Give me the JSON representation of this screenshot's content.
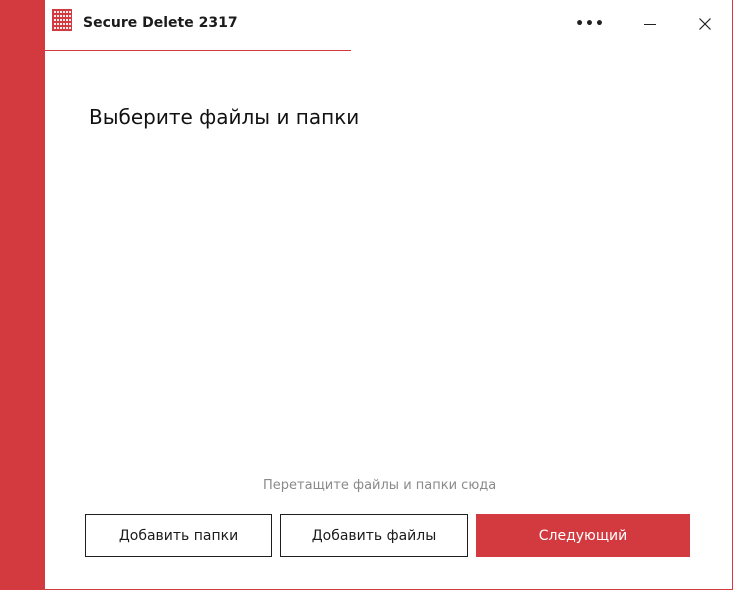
{
  "app": {
    "title": "Secure Delete 2317",
    "logo_icon": "binary-code-icon"
  },
  "window_controls": {
    "more_label": "•••",
    "minimize_icon": "minimize-icon",
    "close_icon": "close-icon"
  },
  "main": {
    "heading": "Выберите файлы и папки",
    "drop_hint": "Перетащите файлы и папки сюда"
  },
  "buttons": {
    "add_folders": "Добавить папки",
    "add_files": "Добавить файлы",
    "next": "Следующий"
  },
  "colors": {
    "accent": "#d23a3f",
    "text": "#1b1b1b",
    "hint": "#8a8a8a",
    "background": "#ffffff"
  }
}
